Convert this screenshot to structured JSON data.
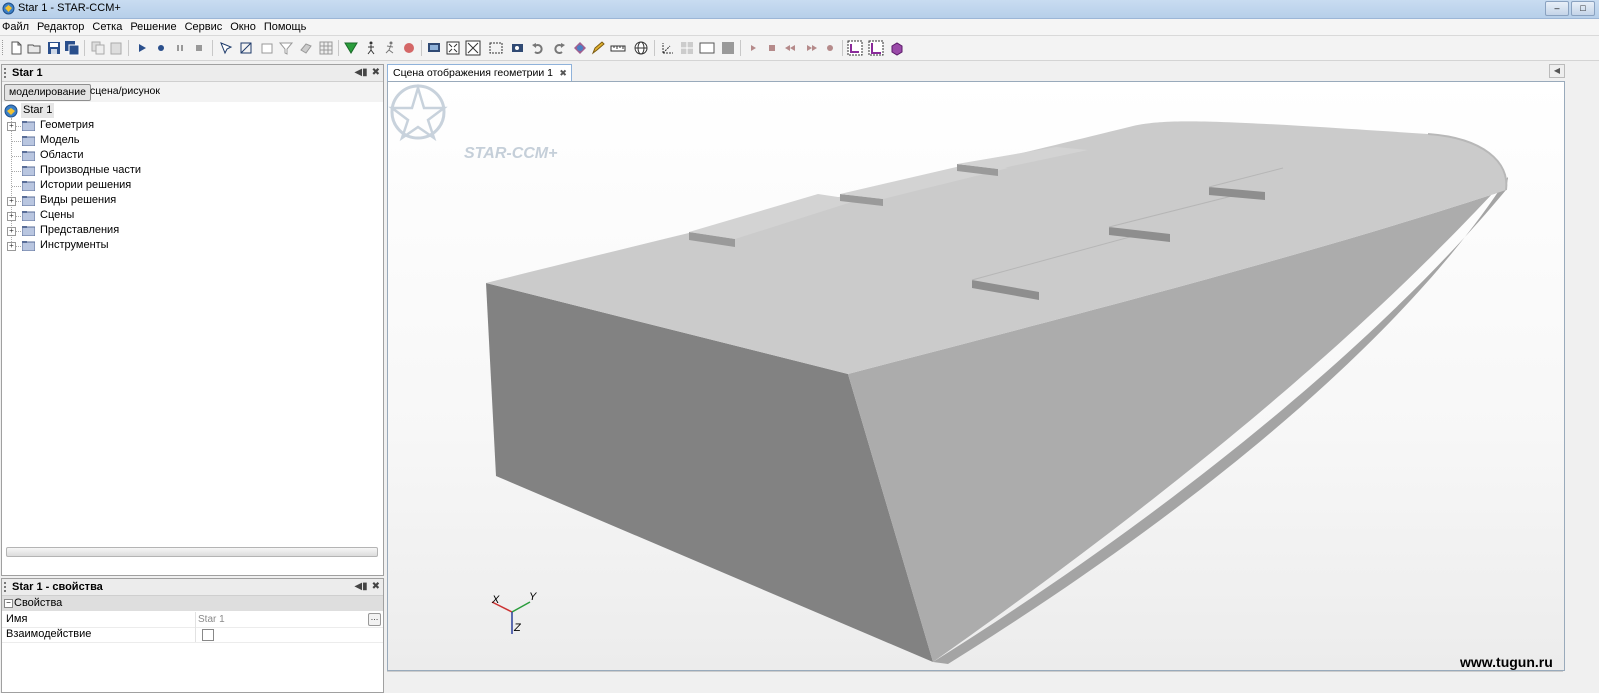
{
  "window": {
    "title": "Star 1 - STAR-CCM+",
    "controls": [
      "–",
      "□"
    ]
  },
  "menu": [
    "Файл",
    "Редактор",
    "Сетка",
    "Решение",
    "Сервис",
    "Окно",
    "Помощь"
  ],
  "toolbar": {
    "icons": [
      "new-file-icon",
      "open-file-icon",
      "save-icon",
      "save-all-icon",
      "copy-icon",
      "paste-icon",
      "run-icon",
      "record-icon",
      "pause-icon",
      "stop-icon",
      "select-icon",
      "transform-icon",
      "box-icon",
      "filter-icon",
      "parts-icon",
      "mesh-icon",
      "flag-icon",
      "walk-icon",
      "run-man-icon",
      "red-dot-icon",
      "screen-icon",
      "fit-icon",
      "crosshair-icon",
      "rect-select-icon",
      "camera-icon",
      "undo-icon",
      "redo-icon",
      "shapes-icon",
      "pencil-icon",
      "ruler-icon",
      "globe-icon",
      "axes-icon",
      "grid-icon",
      "frame-icon",
      "frame2-icon",
      "play-icon",
      "stop2-icon",
      "rewind-icon",
      "forward-icon",
      "dot-icon",
      "corner-icon",
      "corner2-icon",
      "cube-icon"
    ]
  },
  "tree_panel": {
    "title": "Star 1",
    "tabs": [
      "моделирование",
      "сцена/рисунок"
    ],
    "root": "Star 1",
    "items": [
      {
        "label": "Геометрия",
        "expandable": true
      },
      {
        "label": "Модель",
        "expandable": false
      },
      {
        "label": "Области",
        "expandable": false
      },
      {
        "label": "Производные части",
        "expandable": false
      },
      {
        "label": "Истории решения",
        "expandable": false
      },
      {
        "label": "Виды решения",
        "expandable": true
      },
      {
        "label": "Сцены",
        "expandable": true
      },
      {
        "label": "Представления",
        "expandable": true
      },
      {
        "label": "Инструменты",
        "expandable": true
      }
    ]
  },
  "properties_panel": {
    "title": "Star 1 - свойства",
    "section": "Свойства",
    "rows": [
      {
        "key": "Имя",
        "value": "Star 1"
      },
      {
        "key": "Взаимодействие",
        "value": ""
      }
    ]
  },
  "scene": {
    "tab_label": "Сцена отображения геометрии 1",
    "logo_text": "STAR-CCM+",
    "axes": {
      "x": "X",
      "y": "Y",
      "z": "Z"
    }
  },
  "watermark": "www.tugun.ru"
}
